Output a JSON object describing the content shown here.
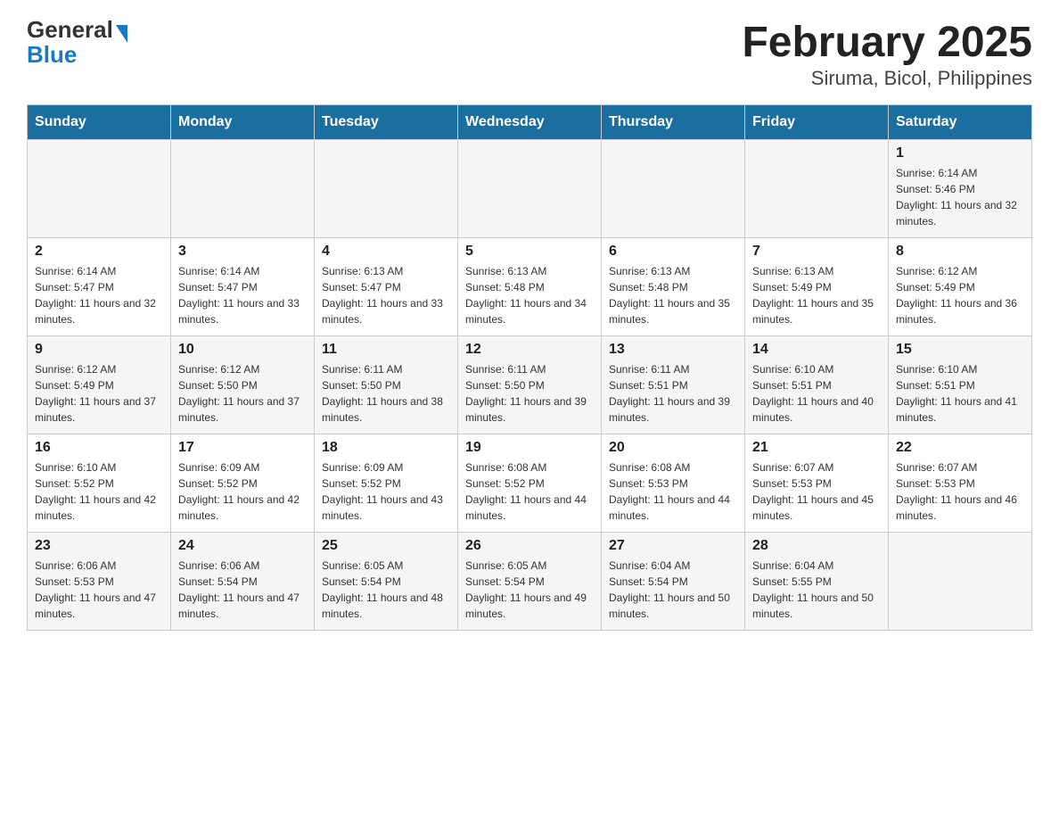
{
  "header": {
    "logo_general": "General",
    "logo_blue": "Blue",
    "title": "February 2025",
    "subtitle": "Siruma, Bicol, Philippines"
  },
  "weekdays": [
    "Sunday",
    "Monday",
    "Tuesday",
    "Wednesday",
    "Thursday",
    "Friday",
    "Saturday"
  ],
  "weeks": [
    [
      {
        "day": "",
        "info": ""
      },
      {
        "day": "",
        "info": ""
      },
      {
        "day": "",
        "info": ""
      },
      {
        "day": "",
        "info": ""
      },
      {
        "day": "",
        "info": ""
      },
      {
        "day": "",
        "info": ""
      },
      {
        "day": "1",
        "info": "Sunrise: 6:14 AM\nSunset: 5:46 PM\nDaylight: 11 hours and 32 minutes."
      }
    ],
    [
      {
        "day": "2",
        "info": "Sunrise: 6:14 AM\nSunset: 5:47 PM\nDaylight: 11 hours and 32 minutes."
      },
      {
        "day": "3",
        "info": "Sunrise: 6:14 AM\nSunset: 5:47 PM\nDaylight: 11 hours and 33 minutes."
      },
      {
        "day": "4",
        "info": "Sunrise: 6:13 AM\nSunset: 5:47 PM\nDaylight: 11 hours and 33 minutes."
      },
      {
        "day": "5",
        "info": "Sunrise: 6:13 AM\nSunset: 5:48 PM\nDaylight: 11 hours and 34 minutes."
      },
      {
        "day": "6",
        "info": "Sunrise: 6:13 AM\nSunset: 5:48 PM\nDaylight: 11 hours and 35 minutes."
      },
      {
        "day": "7",
        "info": "Sunrise: 6:13 AM\nSunset: 5:49 PM\nDaylight: 11 hours and 35 minutes."
      },
      {
        "day": "8",
        "info": "Sunrise: 6:12 AM\nSunset: 5:49 PM\nDaylight: 11 hours and 36 minutes."
      }
    ],
    [
      {
        "day": "9",
        "info": "Sunrise: 6:12 AM\nSunset: 5:49 PM\nDaylight: 11 hours and 37 minutes."
      },
      {
        "day": "10",
        "info": "Sunrise: 6:12 AM\nSunset: 5:50 PM\nDaylight: 11 hours and 37 minutes."
      },
      {
        "day": "11",
        "info": "Sunrise: 6:11 AM\nSunset: 5:50 PM\nDaylight: 11 hours and 38 minutes."
      },
      {
        "day": "12",
        "info": "Sunrise: 6:11 AM\nSunset: 5:50 PM\nDaylight: 11 hours and 39 minutes."
      },
      {
        "day": "13",
        "info": "Sunrise: 6:11 AM\nSunset: 5:51 PM\nDaylight: 11 hours and 39 minutes."
      },
      {
        "day": "14",
        "info": "Sunrise: 6:10 AM\nSunset: 5:51 PM\nDaylight: 11 hours and 40 minutes."
      },
      {
        "day": "15",
        "info": "Sunrise: 6:10 AM\nSunset: 5:51 PM\nDaylight: 11 hours and 41 minutes."
      }
    ],
    [
      {
        "day": "16",
        "info": "Sunrise: 6:10 AM\nSunset: 5:52 PM\nDaylight: 11 hours and 42 minutes."
      },
      {
        "day": "17",
        "info": "Sunrise: 6:09 AM\nSunset: 5:52 PM\nDaylight: 11 hours and 42 minutes."
      },
      {
        "day": "18",
        "info": "Sunrise: 6:09 AM\nSunset: 5:52 PM\nDaylight: 11 hours and 43 minutes."
      },
      {
        "day": "19",
        "info": "Sunrise: 6:08 AM\nSunset: 5:52 PM\nDaylight: 11 hours and 44 minutes."
      },
      {
        "day": "20",
        "info": "Sunrise: 6:08 AM\nSunset: 5:53 PM\nDaylight: 11 hours and 44 minutes."
      },
      {
        "day": "21",
        "info": "Sunrise: 6:07 AM\nSunset: 5:53 PM\nDaylight: 11 hours and 45 minutes."
      },
      {
        "day": "22",
        "info": "Sunrise: 6:07 AM\nSunset: 5:53 PM\nDaylight: 11 hours and 46 minutes."
      }
    ],
    [
      {
        "day": "23",
        "info": "Sunrise: 6:06 AM\nSunset: 5:53 PM\nDaylight: 11 hours and 47 minutes."
      },
      {
        "day": "24",
        "info": "Sunrise: 6:06 AM\nSunset: 5:54 PM\nDaylight: 11 hours and 47 minutes."
      },
      {
        "day": "25",
        "info": "Sunrise: 6:05 AM\nSunset: 5:54 PM\nDaylight: 11 hours and 48 minutes."
      },
      {
        "day": "26",
        "info": "Sunrise: 6:05 AM\nSunset: 5:54 PM\nDaylight: 11 hours and 49 minutes."
      },
      {
        "day": "27",
        "info": "Sunrise: 6:04 AM\nSunset: 5:54 PM\nDaylight: 11 hours and 50 minutes."
      },
      {
        "day": "28",
        "info": "Sunrise: 6:04 AM\nSunset: 5:55 PM\nDaylight: 11 hours and 50 minutes."
      },
      {
        "day": "",
        "info": ""
      }
    ]
  ]
}
